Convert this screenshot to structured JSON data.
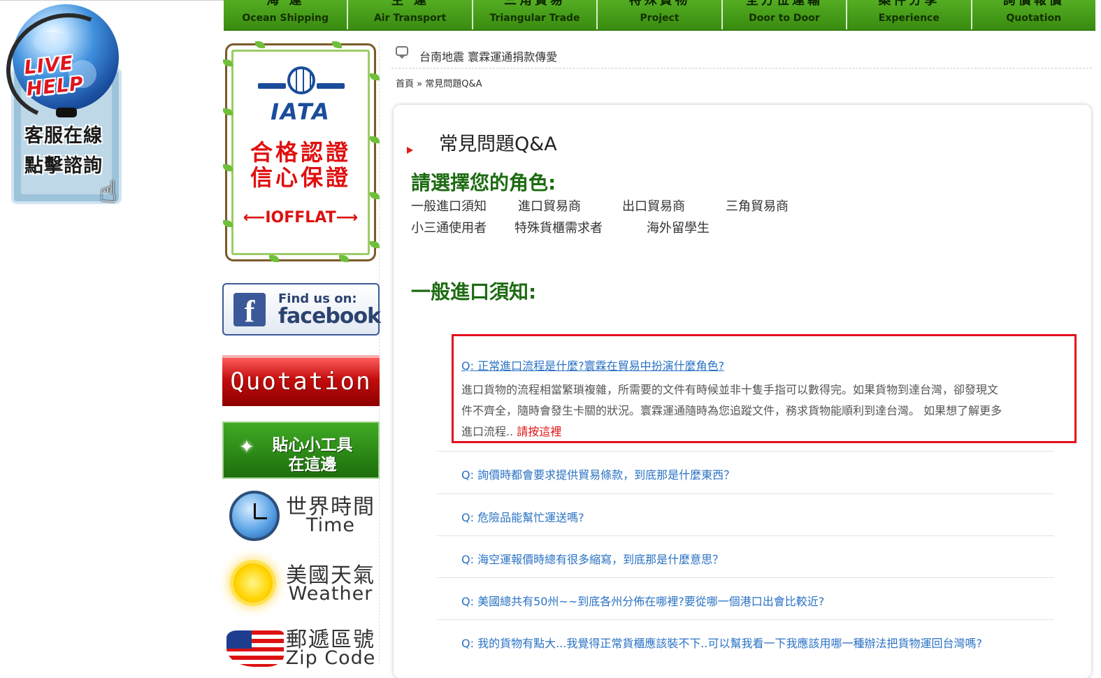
{
  "nav": [
    {
      "zh": "海 運",
      "en": "Ocean Shipping"
    },
    {
      "zh": "空 運",
      "en": "Air Transport"
    },
    {
      "zh": "三角貿易",
      "en": "Triangular Trade"
    },
    {
      "zh": "特殊貨物",
      "en": "Project"
    },
    {
      "zh": "全方位運輸",
      "en": "Door to Door"
    },
    {
      "zh": "案件分享",
      "en": "Experience"
    },
    {
      "zh": "詢價報價",
      "en": "Quotation"
    }
  ],
  "live_help": {
    "title": "LIVE HELP",
    "line1": "客服在線",
    "line2": "點擊諮詢"
  },
  "iata_banner": {
    "logo_text": "IATA",
    "line1": "合格認證",
    "line2": "信心保證",
    "brand": "IOFFLAT"
  },
  "facebook": {
    "find": "Find us on:",
    "word": "facebook"
  },
  "quotation_banner": {
    "label": "Quotation"
  },
  "tools_banner": {
    "line1": "貼心小工具",
    "line2": "在這邊"
  },
  "widgets": {
    "time": {
      "zh": "世界時間",
      "en": "Time"
    },
    "weather": {
      "zh": "美國天氣",
      "en": "Weather"
    },
    "zip": {
      "zh": "郵遞區號",
      "en": "Zip Code"
    }
  },
  "news": {
    "text": "台南地震 寰霖運通捐款傳愛"
  },
  "breadcrumb": {
    "home": "首頁",
    "sep": "»",
    "current": "常見問題Q&A"
  },
  "page": {
    "title": "常見問題Q&A",
    "role_heading": "請選擇您的角色:",
    "roles": [
      "一般進口須知",
      "進口貿易商",
      "出口貿易商",
      "三角貿易商",
      "小三通使用者",
      "特殊貨櫃需求者",
      "海外留學生"
    ],
    "section_heading": "一般進口須知:"
  },
  "faq": [
    {
      "q": "Q: 正常進口流程是什麼?寰霖在貿易中扮演什麼角色?",
      "answer_lines": [
        "進口貨物的流程相當繁瑣複雜，所需要的文件有時候並非十隻手指可以數得完。如果貨物到達台灣，卻發現文",
        "件不齊全，隨時會發生卡關的狀況。寰霖運通隨時為您追蹤文件，務求貨物能順利到達台灣。 如果想了解更多",
        "進口流程.. "
      ],
      "more": "請按這裡"
    },
    {
      "q": "Q: 詢價時都會要求提供貿易條款，到底那是什麼東西？"
    },
    {
      "q": "Q: 危險品能幫忙運送嗎?"
    },
    {
      "q": "Q: 海空運報價時總有很多縮寫，到底那是什麼意思？"
    },
    {
      "q": "Q: 美國總共有50州~~到底各州分佈在哪裡?要從哪一個港口出會比較近?"
    },
    {
      "q": "Q: 我的貨物有點大...我覺得正常貨櫃應該裝不下..可以幫我看一下我應該用哪一種辦法把貨物運回台灣嗎?"
    }
  ],
  "colors": {
    "nav_green": "#3f9a12",
    "heading_green": "#1d6b12",
    "link_blue": "#2a72c4",
    "highlight_red": "#e3101e"
  }
}
